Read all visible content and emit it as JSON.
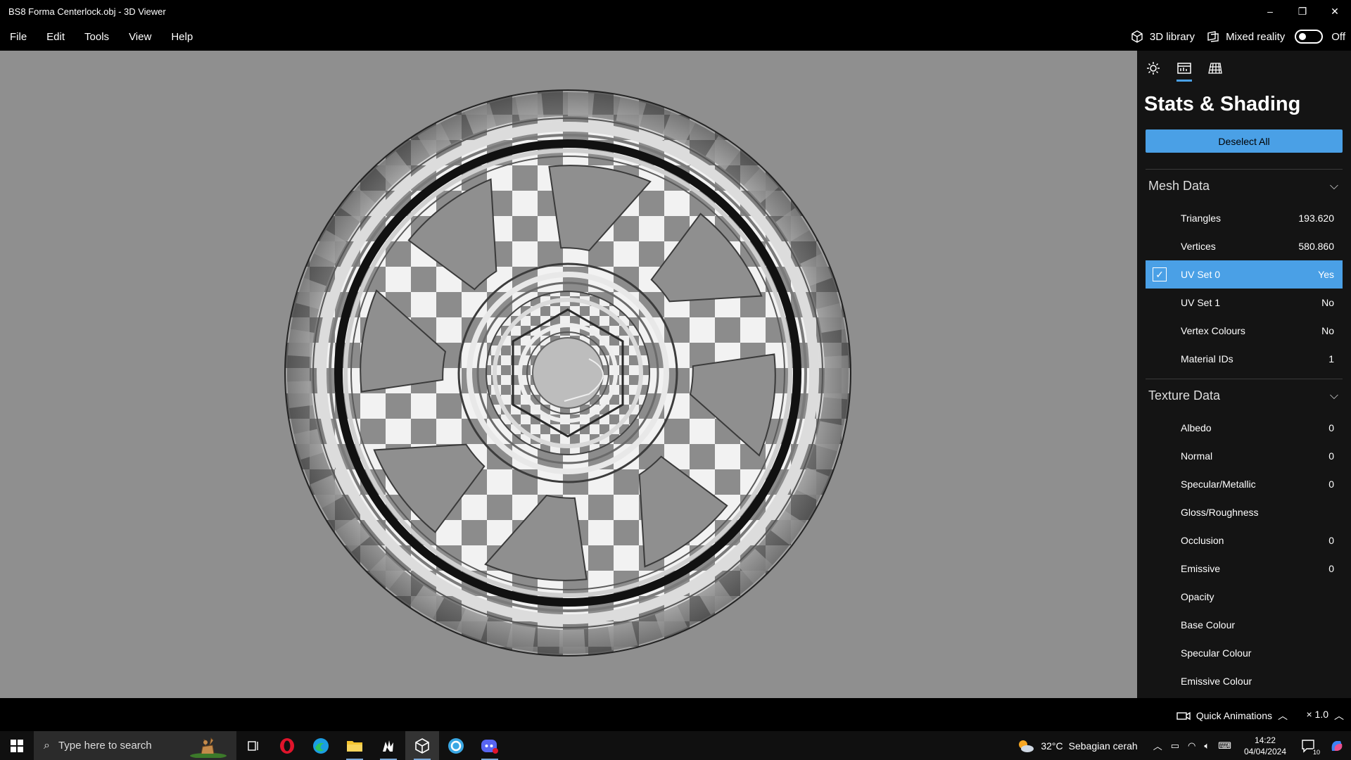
{
  "window": {
    "title": "BS8 Forma Centerlock.obj - 3D Viewer",
    "minimize": "–",
    "restore": "❐",
    "close": "✕"
  },
  "menu": {
    "items": [
      "File",
      "Edit",
      "Tools",
      "View",
      "Help"
    ],
    "library_label": "3D library",
    "mixed_reality_label": "Mixed reality",
    "mixed_reality_state": "Off"
  },
  "panel": {
    "title": "Stats & Shading",
    "deselect_label": "Deselect All",
    "mesh_section": "Mesh Data",
    "mesh_rows": [
      {
        "label": "Triangles",
        "value": "193.620"
      },
      {
        "label": "Vertices",
        "value": "580.860"
      },
      {
        "label": "UV Set 0",
        "value": "Yes"
      },
      {
        "label": "UV Set 1",
        "value": "No"
      },
      {
        "label": "Vertex Colours",
        "value": "No"
      },
      {
        "label": "Material IDs",
        "value": "1"
      }
    ],
    "texture_section": "Texture Data",
    "texture_rows": [
      {
        "label": "Albedo",
        "value": "0"
      },
      {
        "label": "Normal",
        "value": "0"
      },
      {
        "label": "Specular/Metallic",
        "value": "0"
      },
      {
        "label": "Gloss/Roughness",
        "value": ""
      },
      {
        "label": "Occlusion",
        "value": "0"
      },
      {
        "label": "Emissive",
        "value": "0"
      },
      {
        "label": "Opacity",
        "value": ""
      },
      {
        "label": "Base Colour",
        "value": ""
      },
      {
        "label": "Specular Colour",
        "value": ""
      },
      {
        "label": "Emissive Colour",
        "value": ""
      }
    ]
  },
  "bottom": {
    "quick_animations": "Quick Animations",
    "speed": "× 1.0"
  },
  "taskbar": {
    "search_placeholder": "Type here to search",
    "weather_temp": "32°C",
    "weather_text": "Sebagian cerah",
    "time": "14:22",
    "date": "04/04/2024",
    "notification_count": "10"
  },
  "colors": {
    "accent": "#4aa0e6",
    "panel_bg": "#141414",
    "viewport_bg": "#8f8f8f"
  }
}
